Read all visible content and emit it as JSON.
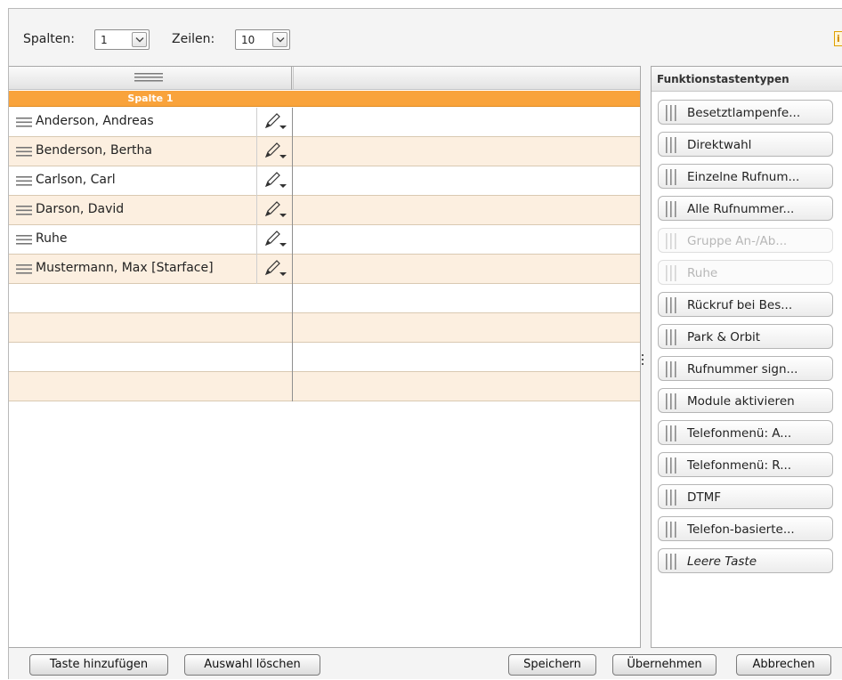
{
  "toolbar": {
    "columns_label": "Spalten:",
    "columns_value": "1",
    "rows_label": "Zeilen:",
    "rows_value": "10",
    "info_glyph": "i"
  },
  "grid": {
    "column_title": "Spalte 1",
    "rows": [
      {
        "name": "Anderson, Andreas"
      },
      {
        "name": "Benderson, Bertha"
      },
      {
        "name": "Carlson, Carl"
      },
      {
        "name": "Darson, David"
      },
      {
        "name": "Ruhe"
      },
      {
        "name": "Mustermann, Max [Starface]"
      },
      {
        "name": ""
      },
      {
        "name": ""
      },
      {
        "name": ""
      },
      {
        "name": ""
      }
    ]
  },
  "panel": {
    "title": "Funktionstastentypen",
    "types": [
      {
        "label": "Besetztlampenfe...",
        "disabled": false,
        "italic": false
      },
      {
        "label": "Direktwahl",
        "disabled": false,
        "italic": false
      },
      {
        "label": "Einzelne Rufnum...",
        "disabled": false,
        "italic": false
      },
      {
        "label": "Alle Rufnummer...",
        "disabled": false,
        "italic": false
      },
      {
        "label": "Gruppe An-/Ab...",
        "disabled": true,
        "italic": false
      },
      {
        "label": "Ruhe",
        "disabled": true,
        "italic": false
      },
      {
        "label": "Rückruf bei Bes...",
        "disabled": false,
        "italic": false
      },
      {
        "label": "Park & Orbit",
        "disabled": false,
        "italic": false
      },
      {
        "label": "Rufnummer sign...",
        "disabled": false,
        "italic": false
      },
      {
        "label": "Module aktivieren",
        "disabled": false,
        "italic": false
      },
      {
        "label": "Telefonmenü: A...",
        "disabled": false,
        "italic": false
      },
      {
        "label": "Telefonmenü: R...",
        "disabled": false,
        "italic": false
      },
      {
        "label": "DTMF",
        "disabled": false,
        "italic": false
      },
      {
        "label": "Telefon-basierte...",
        "disabled": false,
        "italic": false
      },
      {
        "label": "Leere Taste",
        "disabled": false,
        "italic": true
      }
    ]
  },
  "footer": {
    "add_key": "Taste hinzufügen",
    "clear_selection": "Auswahl löschen",
    "save": "Speichern",
    "apply": "Übernehmen",
    "cancel": "Abbrechen"
  },
  "colors": {
    "accent_orange": "#f9a33b",
    "row_alt": "#fcefe0"
  }
}
